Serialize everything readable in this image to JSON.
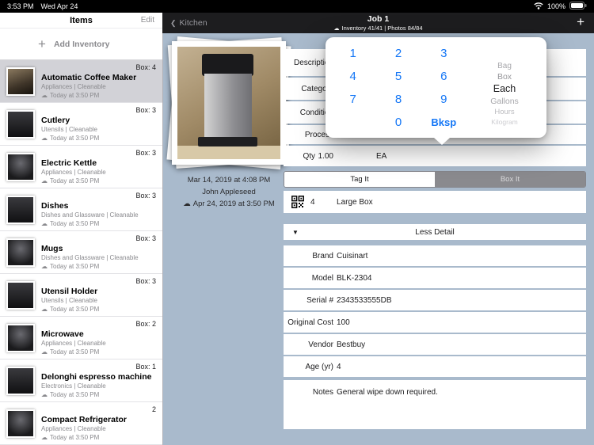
{
  "colors": {
    "accent_blue": "#1577f6",
    "content_bg": "#a9bacc",
    "nav_bg": "#1d1d1f"
  },
  "icons": {
    "cloud": "☁",
    "chevron_left": "❮",
    "plus": "+",
    "triangle_down": "▼"
  },
  "status_bar": {
    "time": "3:53 PM",
    "date": "Wed Apr 24",
    "battery_percent": "100%"
  },
  "sidebar": {
    "title": "Items",
    "edit_label": "Edit",
    "add_label": "Add Inventory",
    "items": [
      {
        "name": "Automatic Coffee Maker",
        "category": "Appliances | Cleanable",
        "synced": "Today at 3:50 PM",
        "box": "Box: 4"
      },
      {
        "name": "Cutlery",
        "category": "Utensils | Cleanable",
        "synced": "Today at 3:50 PM",
        "box": "Box: 3"
      },
      {
        "name": "Electric Kettle",
        "category": "Appliances | Cleanable",
        "synced": "Today at 3:50 PM",
        "box": "Box: 3"
      },
      {
        "name": "Dishes",
        "category": "Dishes and Glassware | Cleanable",
        "synced": "Today at 3:50 PM",
        "box": "Box: 3"
      },
      {
        "name": "Mugs",
        "category": "Dishes and Glassware | Cleanable",
        "synced": "Today at 3:50 PM",
        "box": "Box: 3"
      },
      {
        "name": "Utensil Holder",
        "category": "Utensils | Cleanable",
        "synced": "Today at 3:50 PM",
        "box": "Box: 3"
      },
      {
        "name": "Microwave",
        "category": "Appliances | Cleanable",
        "synced": "Today at 3:50 PM",
        "box": "Box: 2"
      },
      {
        "name": "Delonghi espresso machine",
        "category": "Electronics | Cleanable",
        "synced": "Today at 3:50 PM",
        "box": "Box: 1"
      },
      {
        "name": "Compact Refrigerator",
        "category": "Appliances | Cleanable",
        "synced": "Today at 3:50 PM",
        "box": "2"
      }
    ]
  },
  "nav": {
    "back_label": "Kitchen",
    "title": "Job 1",
    "subtitle": "Inventory 41/41 | Photos 84/84",
    "add_label": "+"
  },
  "photo_card": {
    "taken": "Mar 14, 2019 at 4:08 PM",
    "author": "John Appleseed",
    "synced": "Apr 24, 2019 at 3:50 PM"
  },
  "detail_panel": {
    "field_rows": [
      {
        "label": "Description"
      },
      {
        "label": "Category"
      },
      {
        "label": "Condition"
      },
      {
        "label": "Process"
      }
    ],
    "qty": {
      "label": "Qty",
      "value": "1.00",
      "unit": "EA"
    },
    "segmented": {
      "left": "Tag It",
      "right": "Box It"
    },
    "box_row": {
      "number": "4",
      "type": "Large Box"
    },
    "section": {
      "title": "Less Detail"
    },
    "detail_rows": [
      {
        "label": "Brand",
        "value": "Cuisinart"
      },
      {
        "label": "Model",
        "value": "BLK-2304"
      },
      {
        "label": "Serial #",
        "value": "2343533555DB"
      },
      {
        "label": "Original Cost",
        "value": "100"
      },
      {
        "label": "Vendor",
        "value": "Bestbuy"
      },
      {
        "label": "Age (yr)",
        "value": "4"
      }
    ],
    "notes": {
      "label": "Notes",
      "value": "General wipe down required."
    }
  },
  "popover": {
    "keys": [
      "1",
      "2",
      "3",
      "4",
      "5",
      "6",
      "7",
      "8",
      "9",
      "0",
      "Bksp"
    ],
    "units": [
      "Bag",
      "Box",
      "Each",
      "Gallons",
      "Hours",
      "Kilogram"
    ],
    "selected_unit": "Each"
  }
}
